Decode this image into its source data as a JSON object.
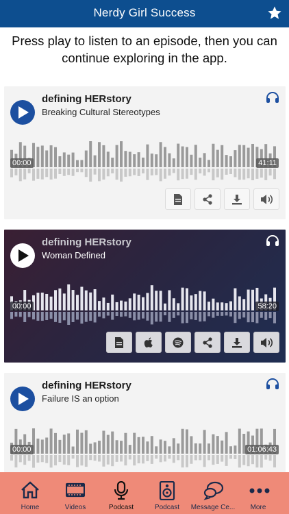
{
  "header": {
    "title": "Nerdy Girl Success",
    "star_icon": "star-icon"
  },
  "intro": "Press play to listen to an episode, then you can continue exploring in the app.",
  "episodes": [
    {
      "show": "defining HERstory",
      "title": "Breaking Cultural Stereotypes",
      "start": "00:00",
      "duration": "41:11",
      "theme": "light",
      "buttons": [
        "document-icon",
        "share-icon",
        "download-icon",
        "volume-icon"
      ]
    },
    {
      "show": "defining HERstory",
      "title": "Woman Defined",
      "start": "00:00",
      "duration": "58:20",
      "theme": "dark",
      "buttons": [
        "document-icon",
        "apple-icon",
        "spotify-icon",
        "share-icon",
        "download-icon",
        "volume-icon"
      ]
    },
    {
      "show": "defining HERstory",
      "title": "Failure IS an option",
      "start": "00:00",
      "duration": "01:06:43",
      "theme": "light",
      "buttons": []
    }
  ],
  "tabs": [
    {
      "label": "Home",
      "icon": "home-icon"
    },
    {
      "label": "Videos",
      "icon": "film-icon"
    },
    {
      "label": "Podcast",
      "icon": "microphone-icon",
      "active": true
    },
    {
      "label": "Podcast",
      "icon": "speaker-icon"
    },
    {
      "label": "Message Ce...",
      "icon": "chat-icon"
    },
    {
      "label": "More",
      "icon": "more-icon"
    }
  ]
}
